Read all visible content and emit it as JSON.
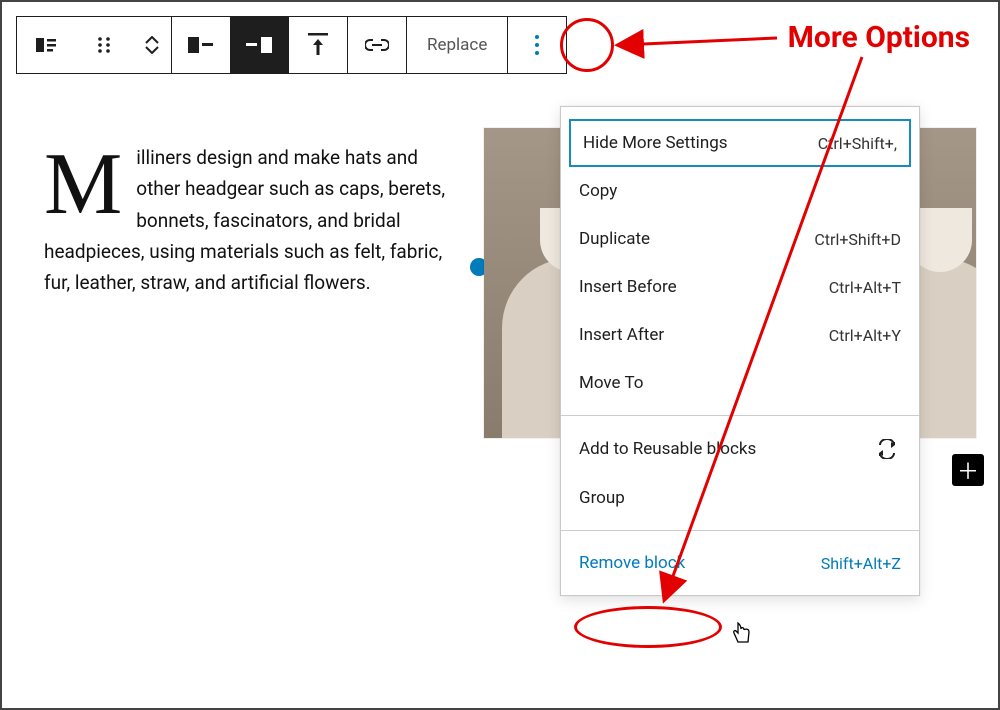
{
  "toolbar": {
    "replace_label": "Replace"
  },
  "text": {
    "dropcap": "M",
    "body": "illiners design and make hats and other headgear such as caps, berets, bonnets, fascinators, and bridal headpieces, using materials such as felt, fabric, fur, leather, straw, and artificial flowers."
  },
  "menu": {
    "section1": [
      {
        "label": "Hide More Settings",
        "shortcut": "Ctrl+Shift+,"
      },
      {
        "label": "Copy",
        "shortcut": ""
      },
      {
        "label": "Duplicate",
        "shortcut": "Ctrl+Shift+D"
      },
      {
        "label": "Insert Before",
        "shortcut": "Ctrl+Alt+T"
      },
      {
        "label": "Insert After",
        "shortcut": "Ctrl+Alt+Y"
      },
      {
        "label": "Move To",
        "shortcut": ""
      }
    ],
    "section2": [
      {
        "label": "Add to Reusable blocks",
        "icon": "reusable"
      },
      {
        "label": "Group"
      }
    ],
    "section3": [
      {
        "label": "Remove block",
        "shortcut": "Shift+Alt+Z"
      }
    ]
  },
  "annotation": {
    "label": "More Options"
  }
}
